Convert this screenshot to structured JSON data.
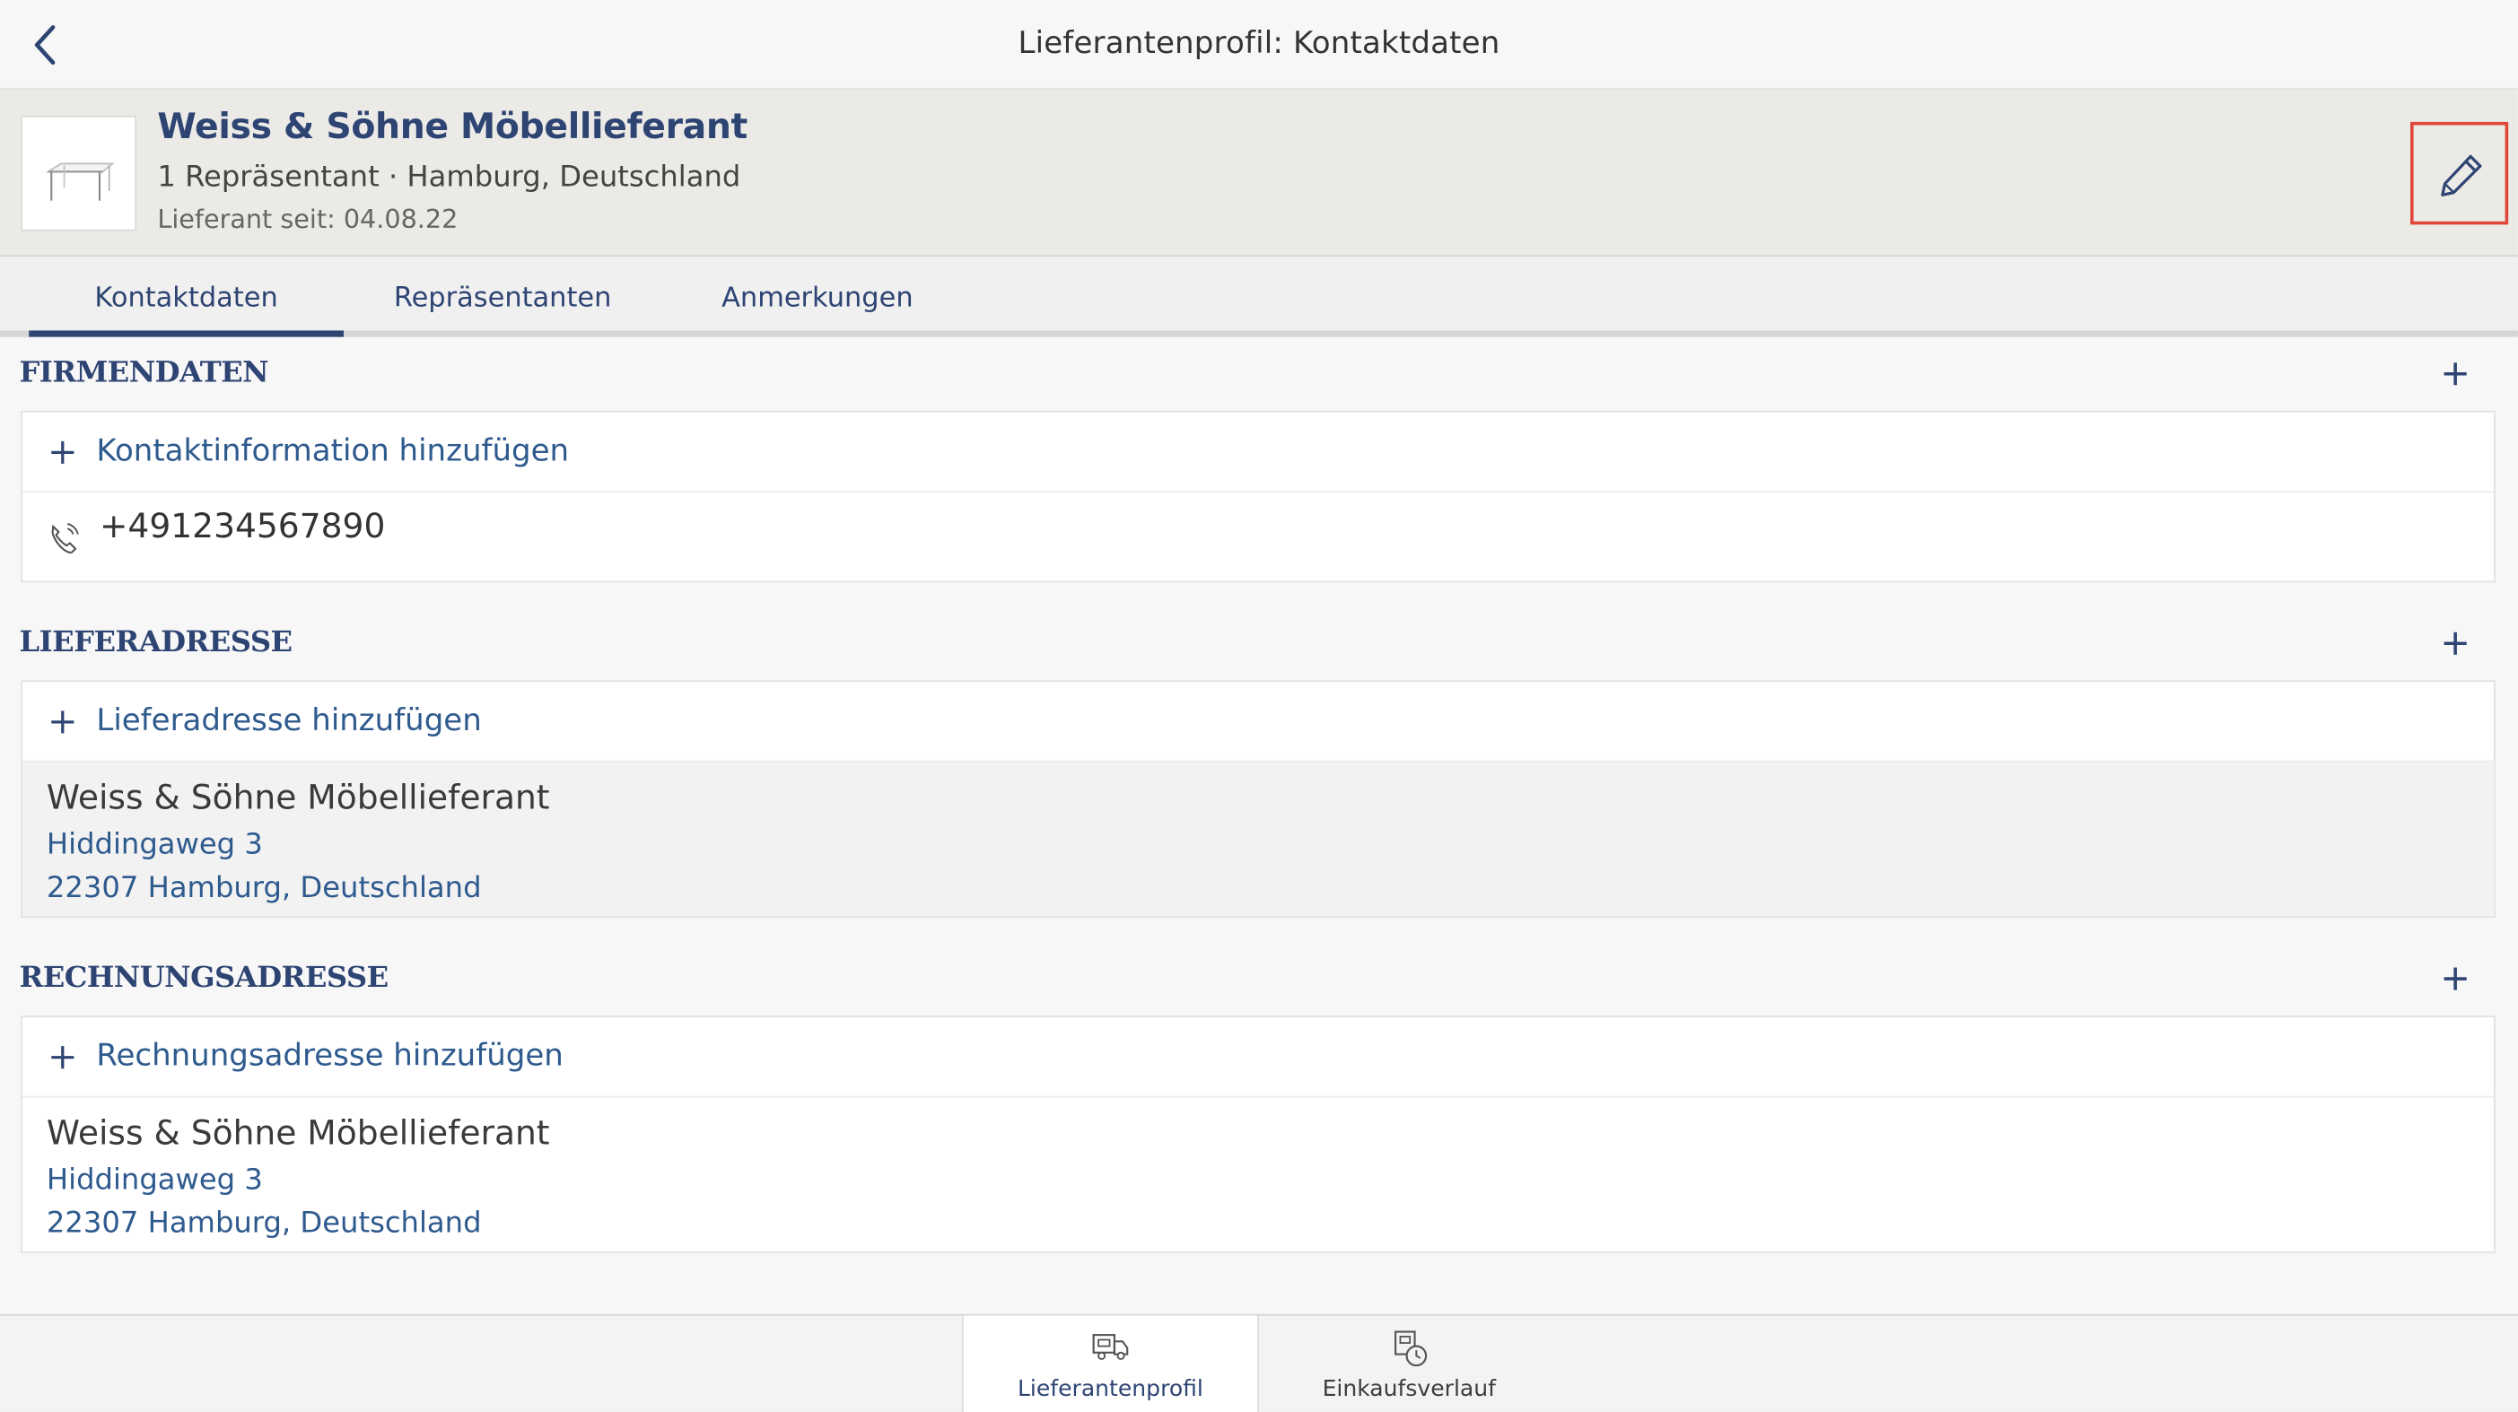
{
  "nav": {
    "title": "Lieferantenprofil: Kontaktdaten",
    "back_icon": "chevron-left-icon"
  },
  "supplier": {
    "name": "Weiss & Söhne Möbellieferant",
    "subtitle": "1 Repräsentant · Hamburg, Deutschland",
    "since": "Lieferant seit: 04.08.22",
    "thumbnail_icon": "table-furniture-icon",
    "edit_icon": "pencil-icon"
  },
  "tabs": [
    {
      "label": "Kontaktdaten",
      "active": true
    },
    {
      "label": "Repräsentanten",
      "active": false
    },
    {
      "label": "Anmerkungen",
      "active": false
    }
  ],
  "sections": {
    "firmendaten": {
      "title": "FIRMENDATEN",
      "add_label": "Kontaktinformation hinzufügen",
      "phone": "+491234567890"
    },
    "lieferadresse": {
      "title": "LIEFERADRESSE",
      "add_label": "Lieferadresse hinzufügen",
      "address": {
        "name": "Weiss & Söhne Möbellieferant",
        "street": "Hiddingaweg 3",
        "city": "22307 Hamburg, Deutschland"
      }
    },
    "rechnungsadresse": {
      "title": "RECHNUNGSADRESSE",
      "add_label": "Rechnungsadresse hinzufügen",
      "address": {
        "name": "Weiss & Söhne Möbellieferant",
        "street": "Hiddingaweg 3",
        "city": "22307 Hamburg, Deutschland"
      }
    }
  },
  "bottom_tabs": [
    {
      "label": "Lieferantenprofil",
      "icon": "supplier-truck-icon",
      "active": true
    },
    {
      "label": "Einkaufsverlauf",
      "icon": "purchase-history-icon",
      "active": false
    }
  ],
  "colors": {
    "accent": "#2e4473",
    "link": "#2e5a8e",
    "highlight_border": "#e0473a",
    "header_bg": "#ebeae6"
  }
}
